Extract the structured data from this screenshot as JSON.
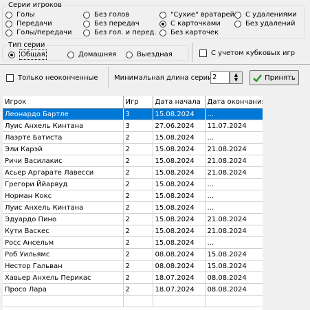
{
  "series_group": {
    "title": "Серии игроков",
    "options": [
      {
        "label": "Голы",
        "checked": false
      },
      {
        "label": "Без голов",
        "checked": false
      },
      {
        "label": "\"Сухие\" вратарей",
        "checked": false
      },
      {
        "label": "С удалениями",
        "checked": false
      },
      {
        "label": "Передачи",
        "checked": false
      },
      {
        "label": "Без передач",
        "checked": false
      },
      {
        "label": "С карточками",
        "checked": true
      },
      {
        "label": "Без удалений",
        "checked": false
      },
      {
        "label": "Голы/передачи",
        "checked": false
      },
      {
        "label": "Без гол. и перед.",
        "checked": false
      },
      {
        "label": "Без карточек",
        "checked": false
      }
    ]
  },
  "type_group": {
    "title": "Тип серии",
    "options": [
      {
        "label": "Общая",
        "checked": true
      },
      {
        "label": "Домашняя",
        "checked": false
      },
      {
        "label": "Выездная",
        "checked": false
      }
    ]
  },
  "cup_checkbox": {
    "label": "С учетом кубковых игр",
    "checked": false
  },
  "unfinished_checkbox": {
    "label": "Только неоконченные",
    "checked": false
  },
  "min_length": {
    "label": "Минимальная длина серии",
    "value": "2"
  },
  "accept_button": {
    "label": "Принять"
  },
  "table": {
    "columns": [
      "Игрок",
      "Игр",
      "Дата начала",
      "Дата окончания"
    ],
    "selected_row": 0,
    "rows": [
      [
        "Леонардо Бартле",
        "3",
        "15.08.2024",
        "..."
      ],
      [
        "Луис Анхель Кинтана",
        "3",
        "27.06.2024",
        "11.07.2024"
      ],
      [
        "Лаэрте Батиста",
        "2",
        "15.08.2024",
        "..."
      ],
      [
        "Эли Карэй",
        "2",
        "15.08.2024",
        "21.08.2024"
      ],
      [
        "Ричи Василакис",
        "2",
        "15.08.2024",
        "21.08.2024"
      ],
      [
        "Асьер Аргарате Лавесси",
        "2",
        "15.08.2024",
        "21.08.2024"
      ],
      [
        "Грегори Ййарвуд",
        "2",
        "15.08.2024",
        "..."
      ],
      [
        "Норман Кокс",
        "2",
        "15.08.2024",
        "..."
      ],
      [
        "Луис Анхель Кинтана",
        "2",
        "15.08.2024",
        "..."
      ],
      [
        "Эдуардо Пино",
        "2",
        "15.08.2024",
        "21.08.2024"
      ],
      [
        "Кути Васкес",
        "2",
        "15.08.2024",
        "21.08.2024"
      ],
      [
        "Росс Ансельм",
        "2",
        "15.08.2024",
        "..."
      ],
      [
        "Роб Уильямс",
        "2",
        "08.08.2024",
        "15.08.2024"
      ],
      [
        "Нестор Гальван",
        "2",
        "08.08.2024",
        "15.08.2024"
      ],
      [
        "Хавьер Анхель Перикас",
        "2",
        "18.07.2024",
        "08.08.2024"
      ],
      [
        "Просо Лара",
        "2",
        "18.07.2024",
        "08.08.2024"
      ],
      [
        "",
        "",
        "",
        ""
      ]
    ]
  },
  "colors": {
    "selection": "#0078d7",
    "accept_check": "#2e9a2e"
  }
}
